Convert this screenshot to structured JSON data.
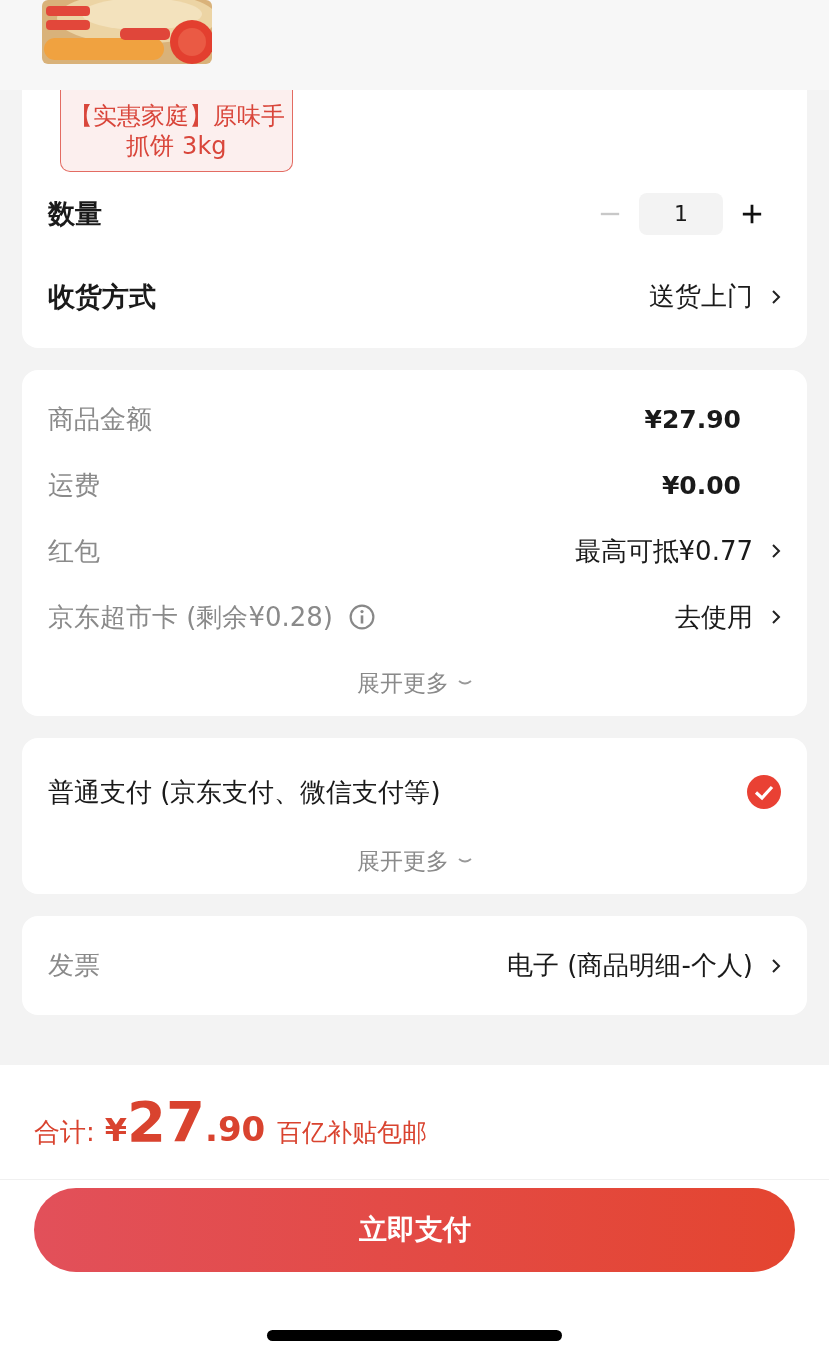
{
  "product_tag": {
    "lines": [
      "【实惠家庭】原味手",
      "抓饼 3kg"
    ]
  },
  "order_options": [
    {
      "kind": "stepper",
      "label": "数量",
      "value": "1",
      "decrement_disabled": true
    },
    {
      "kind": "select",
      "label": "收货方式",
      "value": "送货上门"
    }
  ],
  "price_details": {
    "rows": [
      {
        "kind": "amount",
        "label": "商品金额",
        "value": "¥27.90"
      },
      {
        "kind": "amount",
        "label": "运费",
        "value": "¥0.00"
      },
      {
        "kind": "link",
        "label": "红包",
        "value": "最高可抵¥0.77"
      },
      {
        "kind": "link",
        "label": "京东超市卡 (剩余¥0.28)",
        "info": true,
        "value": "去使用"
      }
    ],
    "expand": "展开更多"
  },
  "payment": {
    "methods": [
      {
        "label": "普通支付 (京东支付、微信支付等)",
        "selected": true
      }
    ],
    "expand": "展开更多"
  },
  "invoice": {
    "label": "发票",
    "value": "电子 (商品明细-个人)"
  },
  "footer": {
    "total_label": "合计:",
    "currency": "¥",
    "amount_int": "27",
    "amount_dec": ".90",
    "note": "百亿补贴包邮",
    "pay_button": "立即支付"
  }
}
